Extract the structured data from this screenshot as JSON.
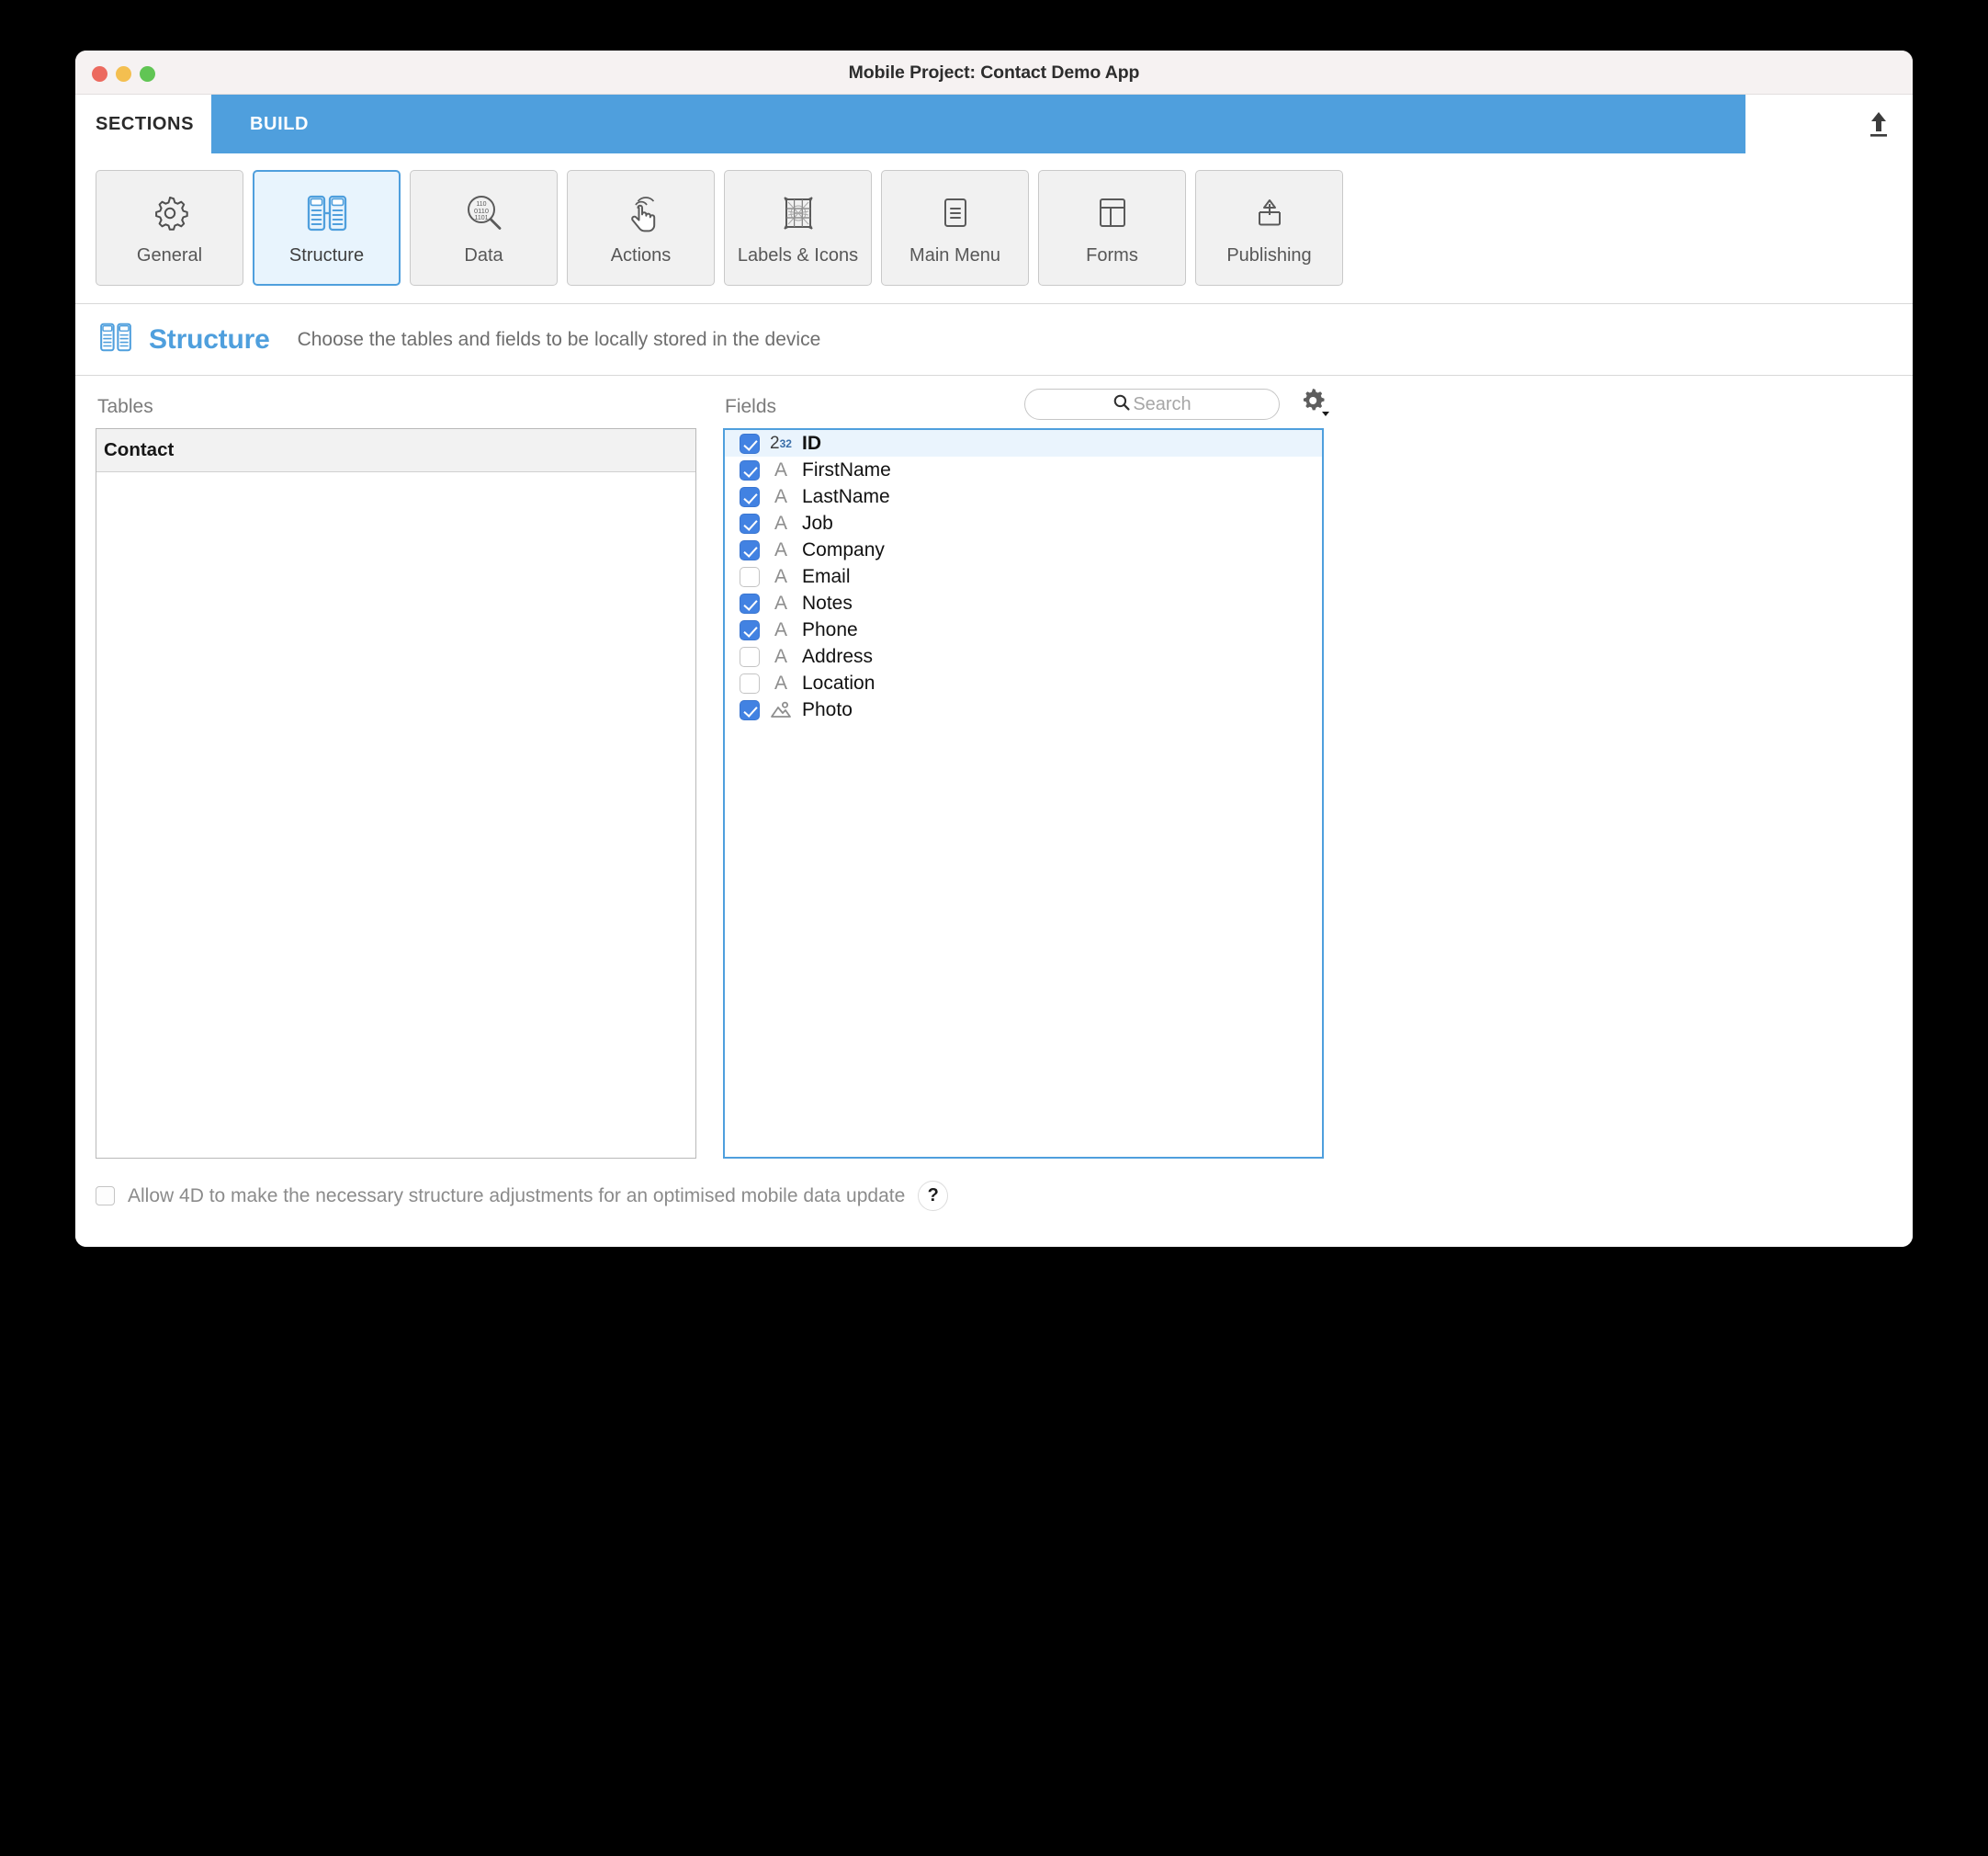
{
  "window": {
    "title": "Mobile Project: Contact Demo App",
    "traffic_lights": [
      "close",
      "minimize",
      "zoom"
    ]
  },
  "tabs": [
    {
      "id": "sections",
      "label": "SECTIONS",
      "active": true
    },
    {
      "id": "build",
      "label": "BUILD",
      "active": false
    }
  ],
  "top_actions": {
    "upload_icon": "upload-icon"
  },
  "sections": [
    {
      "id": "general",
      "label": "General",
      "icon": "gear-icon",
      "active": false
    },
    {
      "id": "structure",
      "label": "Structure",
      "icon": "structure-icon",
      "active": true
    },
    {
      "id": "data",
      "label": "Data",
      "icon": "data-search-icon",
      "active": false
    },
    {
      "id": "actions",
      "label": "Actions",
      "icon": "tap-hand-icon",
      "active": false
    },
    {
      "id": "labels-icons",
      "label": "Labels & Icons",
      "icon": "labels-grid-icon",
      "active": false
    },
    {
      "id": "main-menu",
      "label": "Main Menu",
      "icon": "menu-list-icon",
      "active": false
    },
    {
      "id": "forms",
      "label": "Forms",
      "icon": "layout-icon",
      "active": false
    },
    {
      "id": "publishing",
      "label": "Publishing",
      "icon": "share-up-icon",
      "active": false
    }
  ],
  "section_header": {
    "icon": "structure-icon",
    "title": "Structure",
    "subtitle": "Choose the tables and fields to be locally stored in the device"
  },
  "tables_panel": {
    "label": "Tables",
    "rows": [
      {
        "name": "Contact",
        "selected": true
      }
    ]
  },
  "fields_panel": {
    "label": "Fields",
    "search": {
      "placeholder": "Search",
      "value": "",
      "icon": "search-icon"
    },
    "settings": {
      "icon": "gear-dropdown-icon"
    },
    "rows": [
      {
        "name": "ID",
        "type": "number",
        "type_glyph": "2",
        "type_exp": "32",
        "checked": true,
        "selected": true,
        "bold": true
      },
      {
        "name": "FirstName",
        "type": "alpha",
        "type_glyph": "A",
        "checked": true,
        "selected": false,
        "bold": false
      },
      {
        "name": "LastName",
        "type": "alpha",
        "type_glyph": "A",
        "checked": true,
        "selected": false,
        "bold": false
      },
      {
        "name": "Job",
        "type": "alpha",
        "type_glyph": "A",
        "checked": true,
        "selected": false,
        "bold": false
      },
      {
        "name": "Company",
        "type": "alpha",
        "type_glyph": "A",
        "checked": true,
        "selected": false,
        "bold": false
      },
      {
        "name": "Email",
        "type": "alpha",
        "type_glyph": "A",
        "checked": false,
        "selected": false,
        "bold": false
      },
      {
        "name": "Notes",
        "type": "alpha",
        "type_glyph": "A",
        "checked": true,
        "selected": false,
        "bold": false
      },
      {
        "name": "Phone",
        "type": "alpha",
        "type_glyph": "A",
        "checked": true,
        "selected": false,
        "bold": false
      },
      {
        "name": "Address",
        "type": "alpha",
        "type_glyph": "A",
        "checked": false,
        "selected": false,
        "bold": false
      },
      {
        "name": "Location",
        "type": "alpha",
        "type_glyph": "A",
        "checked": false,
        "selected": false,
        "bold": false
      },
      {
        "name": "Photo",
        "type": "picture",
        "type_glyph": "",
        "checked": true,
        "selected": false,
        "bold": false
      }
    ]
  },
  "footer": {
    "allow_checkbox": {
      "checked": false,
      "label": "Allow 4D to make the necessary structure adjustments for an optimised mobile data update"
    },
    "help": {
      "label": "?"
    }
  },
  "colors": {
    "accent": "#4f9fdd",
    "checkbox_blue": "#4282e2",
    "selection_row": "#eaf4fd",
    "titlebar": "#f6f2f2",
    "panel_header": "#f2f2f2",
    "button_face": "#f1f1f1"
  }
}
